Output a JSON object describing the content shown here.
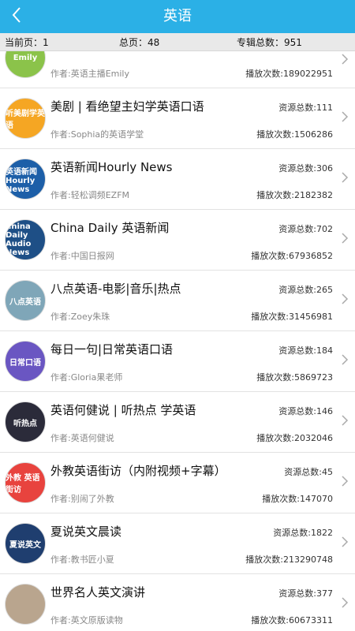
{
  "header": {
    "title": "英语",
    "back_icon": "chevron-left-icon",
    "bg_color": "#2bb0e6"
  },
  "stats": {
    "current_page": "当前页：1",
    "total_pages": "总页：48",
    "total_albums": "专辑总数：951"
  },
  "albums": [
    {
      "name": "",
      "resources": "",
      "author": "作者:英语主播Emily",
      "plays": "播放次数:189022951",
      "cover_text": "Emily",
      "cover_color": "#8bc34a"
    },
    {
      "name": "美剧 | 看绝望主妇学英语口语",
      "resources": "资源总数:111",
      "author": "作者:Sophia的英语学堂",
      "plays": "播放次数:1506286",
      "cover_text": "听美剧学英语",
      "cover_color": "#f5a623"
    },
    {
      "name": "英语新闻Hourly News",
      "resources": "资源总数:306",
      "author": "作者:轻松调频EZFM",
      "plays": "播放次数:2182382",
      "cover_text": "英语新闻 Hourly News",
      "cover_color": "#1d5fa8"
    },
    {
      "name": "China Daily 英语新闻",
      "resources": "资源总数:702",
      "author": "作者:中国日报网",
      "plays": "播放次数:67936852",
      "cover_text": "China Daily Audio News",
      "cover_color": "#1e4f86"
    },
    {
      "name": "八点英语-电影|音乐|热点",
      "resources": "资源总数:265",
      "author": "作者:Zoey朱珠",
      "plays": "播放次数:31456981",
      "cover_text": "八点英语",
      "cover_color": "#7fa6b8"
    },
    {
      "name": "每日一句|日常英语口语",
      "resources": "资源总数:184",
      "author": "作者:Gloria果老师",
      "plays": "播放次数:5869723",
      "cover_text": "日常口语",
      "cover_color": "#6a56c2"
    },
    {
      "name": "英语何健说 | 听热点 学英语",
      "resources": "资源总数:146",
      "author": "作者:英语何健说",
      "plays": "播放次数:2032046",
      "cover_text": "听热点",
      "cover_color": "#2b2b3a"
    },
    {
      "name": "外教英语街访（内附视频+字幕）",
      "resources": "资源总数:45",
      "author": "作者:别闹了外教",
      "plays": "播放次数:147070",
      "cover_text": "外教 英语街访",
      "cover_color": "#e8433e"
    },
    {
      "name": "夏说英文晨读",
      "resources": "资源总数:1822",
      "author": "作者:教书匠小夏",
      "plays": "播放次数:213290748",
      "cover_text": "夏说英文",
      "cover_color": "#1f3e6f"
    },
    {
      "name": "世界名人英文演讲",
      "resources": "资源总数:377",
      "author": "作者:英文原版读物",
      "plays": "播放次数:60673311",
      "cover_text": "",
      "cover_color": "#b9a58e"
    }
  ]
}
